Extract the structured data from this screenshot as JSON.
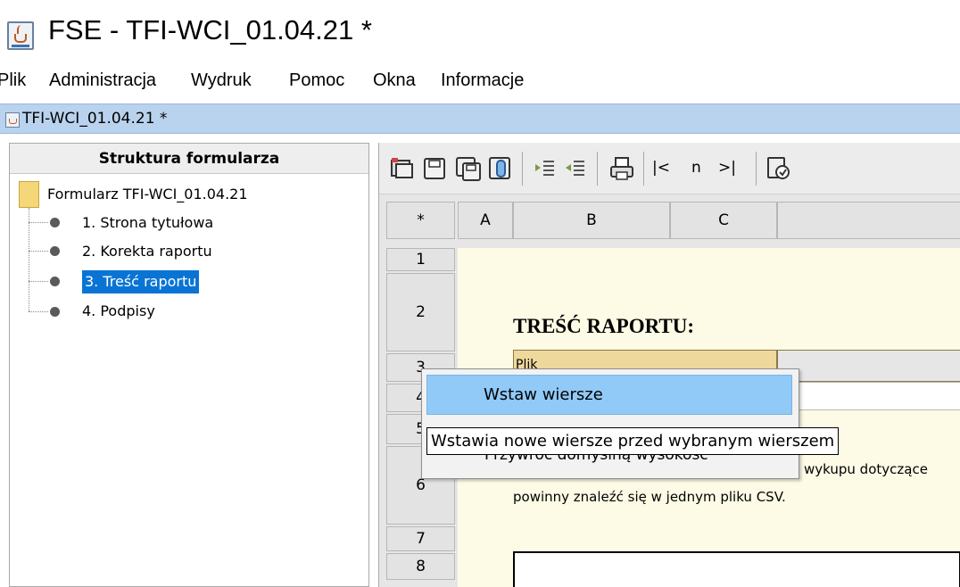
{
  "window": {
    "title": "FSE - TFI-WCI_01.04.21 *"
  },
  "menubar": {
    "items": [
      "Plik",
      "Administracja",
      "Wydruk",
      "Pomoc",
      "Okna",
      "Informacje"
    ]
  },
  "internal_frame": {
    "title": "TFI-WCI_01.04.21 *"
  },
  "tree": {
    "header": "Struktura formularza",
    "root": "Formularz TFI-WCI_01.04.21",
    "items": [
      "1. Strona tytułowa",
      "2. Korekta raportu",
      "3. Treść raportu",
      "4. Podpisy"
    ],
    "selected_index": 2
  },
  "toolbar": {
    "buttons": [
      "open-icon",
      "save-icon",
      "save-as-icon",
      "attach-icon",
      "indent-icon",
      "outdent-icon",
      "print-icon"
    ],
    "nav": {
      "first": "|<",
      "page": "n",
      "last": ">|"
    },
    "tail_button": "validate-icon"
  },
  "sheet": {
    "corner": "*",
    "columns": [
      "A",
      "B",
      "C"
    ],
    "rows": [
      "1",
      "2",
      "3",
      "4",
      "5",
      "6",
      "7",
      "8"
    ],
    "title": "TREŚĆ RAPORTU:",
    "plik_label": "Plik",
    "text_row6_right": "wykupu dotyczące",
    "text_row6_line2": "powinny znaleźć się w jednym pliku CSV."
  },
  "context_menu": {
    "item_insert": "Wstaw wiersze",
    "item_restore": "Przywróć domyślną wysokość"
  },
  "tooltip": "Wstawia nowe wiersze przed wybranym wierszem",
  "colors": {
    "selection": "#0a74d4",
    "menu_highlight": "#91c9f7",
    "sheet_bg": "#fdfbe5",
    "cell_label": "#efd89c",
    "title_bar": "#b9d3ee"
  }
}
